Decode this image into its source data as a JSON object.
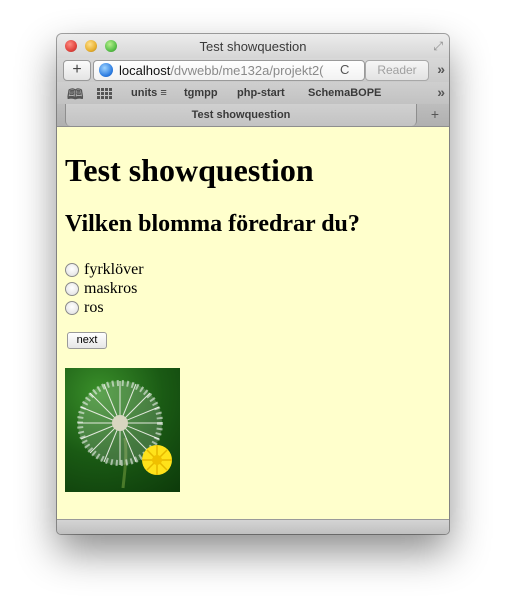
{
  "window": {
    "title": "Test showquestion"
  },
  "toolbar": {
    "new_tab_label": "+",
    "url_host": "localhost",
    "url_path": "/dvwebb/me132a/projekt2(",
    "reload_glyph": "C",
    "reader_label": "Reader",
    "overflow_glyph": "»"
  },
  "bookmarks": {
    "items": [
      {
        "label": "units ≡"
      },
      {
        "label": "tgmpp"
      },
      {
        "label": "php-start"
      },
      {
        "label": "SchemaBOPE"
      }
    ],
    "overflow_glyph": "»"
  },
  "tabs": {
    "active_title": "Test showquestion",
    "new_tab_glyph": "+"
  },
  "page": {
    "heading": "Test showquestion",
    "question": "Vilken blomma föredrar du?",
    "options": [
      {
        "label": "fyrklöver",
        "checked": false
      },
      {
        "label": "maskros",
        "checked": false
      },
      {
        "label": "ros",
        "checked": false
      }
    ],
    "next_label": "next",
    "image_icon": "dandelion-image"
  },
  "colors": {
    "page_background": "#ffffcc",
    "window_chrome": "#d6d6d6"
  }
}
